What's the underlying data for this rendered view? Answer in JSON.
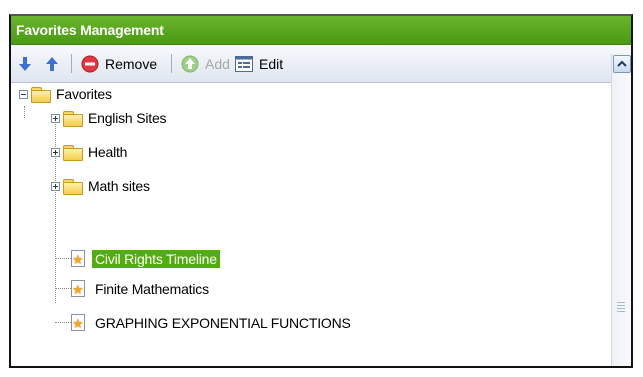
{
  "panel": {
    "title": "Favorites Management"
  },
  "toolbar": {
    "move_down_icon": "arrow-down-icon",
    "move_up_icon": "arrow-up-icon",
    "remove_label": "Remove",
    "add_label": "Add",
    "edit_label": "Edit"
  },
  "tree": {
    "root": {
      "label": "Favorites",
      "expanded": true
    },
    "folders": [
      {
        "label": "English Sites",
        "expanded": false
      },
      {
        "label": "Health",
        "expanded": false
      },
      {
        "label": "Math sites",
        "expanded": false
      }
    ],
    "items": [
      {
        "label": "Civil Rights Timeline",
        "selected": true
      },
      {
        "label": "Finite Mathematics",
        "selected": false
      },
      {
        "label": "GRAPHING EXPONENTIAL FUNCTIONS",
        "selected": false
      }
    ]
  },
  "colors": {
    "header": "#55a51c",
    "selection": "#52ae0e",
    "remove_icon": "#e2383f",
    "add_icon_disabled": "#9fd08a"
  }
}
